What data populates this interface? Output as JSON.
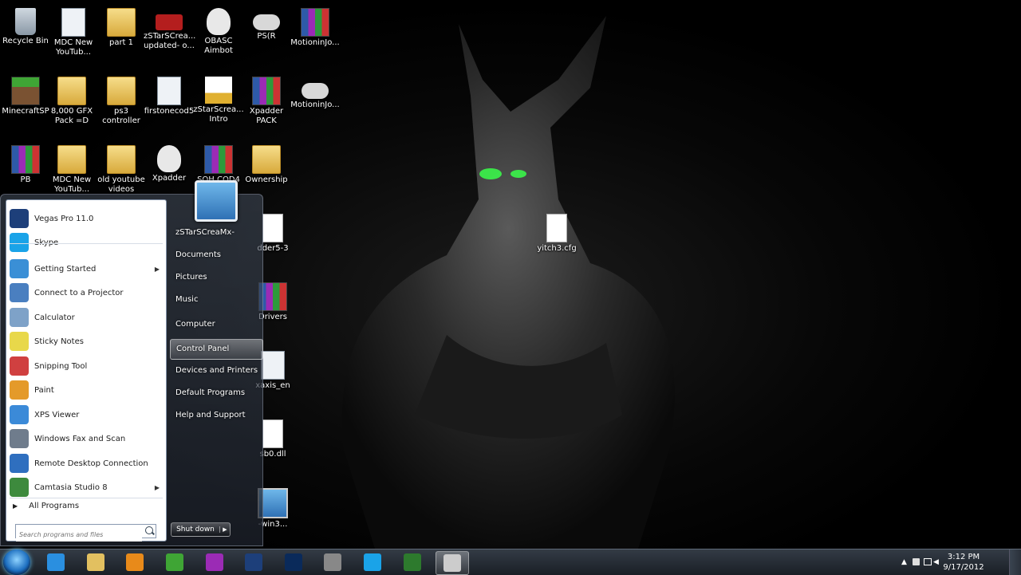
{
  "desktop": {
    "icons": [
      {
        "label": "Recycle Bin"
      },
      {
        "label": "MDC New YouTub..."
      },
      {
        "label": "part 1"
      },
      {
        "label": "zSTarSCrea... updated- o..."
      },
      {
        "label": "OBASC Aimbot"
      },
      {
        "label": "PS(R"
      },
      {
        "label": "MotioninJo..."
      },
      {
        "label": "MinecraftSP"
      },
      {
        "label": "8,000 GFX Pack =D"
      },
      {
        "label": "ps3 controller"
      },
      {
        "label": "firstonecod5"
      },
      {
        "label": "zStarScrea... Intro"
      },
      {
        "label": "Xpadder PACK"
      },
      {
        "label": "MotioninJo..."
      },
      {
        "label": "PB"
      },
      {
        "label": "MDC New YouTub..."
      },
      {
        "label": "old youtube videos"
      },
      {
        "label": "Xpadder"
      },
      {
        "label": "SOH COD4"
      },
      {
        "label": "Ownership"
      },
      {
        "label": "dder5-3"
      },
      {
        "label": "Drivers"
      },
      {
        "label": "xaxis_en"
      },
      {
        "label": "sb0.dll"
      },
      {
        "label": "-win3..."
      },
      {
        "label": "yitch3.cfg"
      }
    ]
  },
  "start_menu": {
    "programs": [
      {
        "label": "Vegas Pro 11.0",
        "color": "#1d3f7a"
      },
      {
        "label": "Skype",
        "color": "#1aa3e8"
      },
      {
        "label": "Getting Started",
        "color": "#3a8fd6",
        "submenu": true
      },
      {
        "label": "Connect to a Projector",
        "color": "#4a7fc0"
      },
      {
        "label": "Calculator",
        "color": "#7ea2c8"
      },
      {
        "label": "Sticky Notes",
        "color": "#e8d84a"
      },
      {
        "label": "Snipping Tool",
        "color": "#d04040"
      },
      {
        "label": "Paint",
        "color": "#e49a2a"
      },
      {
        "label": "XPS Viewer",
        "color": "#3b8ad8"
      },
      {
        "label": "Windows Fax and Scan",
        "color": "#6f7c8c"
      },
      {
        "label": "Remote Desktop Connection",
        "color": "#2f6fbf"
      },
      {
        "label": "Camtasia Studio 8",
        "color": "#3d8a3d",
        "submenu": true
      }
    ],
    "all_programs": "All Programs",
    "search_placeholder": "Search programs and files",
    "user_name": "zSTarSCreaMx-",
    "right_links": [
      "Documents",
      "Pictures",
      "Music",
      "Computer",
      "Control Panel",
      "Devices and Printers",
      "Default Programs",
      "Help and Support"
    ],
    "highlighted_link": "Control Panel",
    "shutdown": "Shut down"
  },
  "taskbar": {
    "apps": [
      {
        "name": "internet-explorer",
        "color": "#2a8fe0"
      },
      {
        "name": "windows-explorer",
        "color": "#e2c060"
      },
      {
        "name": "media-player",
        "color": "#e88a1a"
      },
      {
        "name": "minecraft",
        "color": "#3fa535"
      },
      {
        "name": "winrar",
        "color": "#9b2bb5"
      },
      {
        "name": "vegas-pro",
        "color": "#1d3f7a"
      },
      {
        "name": "photoshop",
        "color": "#0a2a5a"
      },
      {
        "name": "pen-tool",
        "color": "#888888"
      },
      {
        "name": "skype",
        "color": "#1aa3e8"
      },
      {
        "name": "camtasia",
        "color": "#2d7a2d"
      },
      {
        "name": "snipping-tool",
        "color": "#cccccc"
      }
    ],
    "time": "3:12 PM",
    "date": "9/17/2012"
  }
}
